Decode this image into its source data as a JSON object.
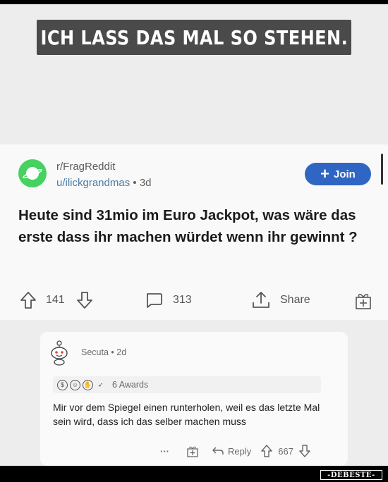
{
  "caption": "ICH LASS DAS MAL SO STEHEN.",
  "post": {
    "subreddit": "r/FragReddit",
    "username": "u/ilickgrandmas",
    "separator": "•",
    "age": "3d",
    "join_label": "Join",
    "join_icon": "plus-icon",
    "title": "Heute sind 31mio im Euro Jackpot, was wäre das erste dass ihr machen würdet wenn ihr gewinnt ?",
    "votes": "141",
    "comments": "313",
    "share_label": "Share"
  },
  "comment": {
    "author": "Secuta",
    "separator": "•",
    "age": "2d",
    "awards_label": "6 Awards",
    "body": "Mir vor dem Spiegel einen runterholen, weil es das letzte Mal sein wird, dass ich das selber machen muss",
    "more": "···",
    "reply_label": "Reply",
    "votes": "667"
  },
  "watermark": "-DEBESTE-",
  "colors": {
    "join_bg": "#2f66c4",
    "subreddit_avatar": "#46d160",
    "caption_bg": "#4a4a4a",
    "username": "#4a7ba5"
  }
}
